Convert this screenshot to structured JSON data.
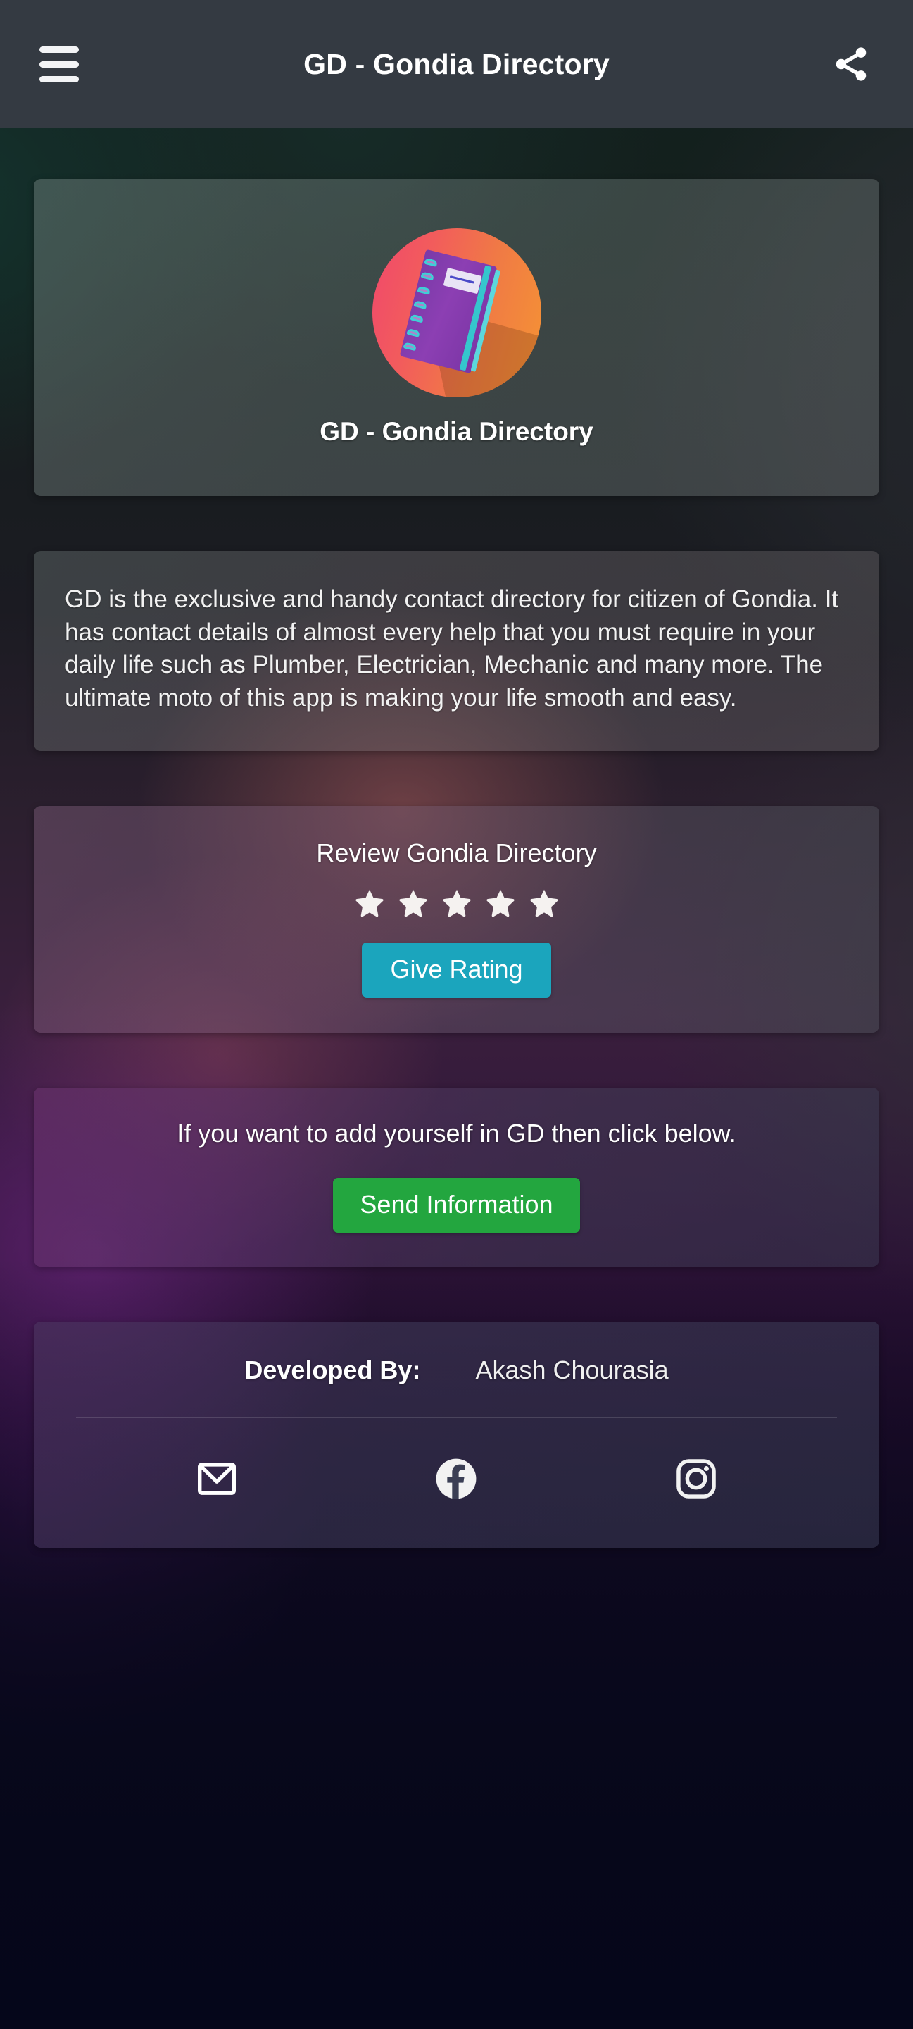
{
  "topbar": {
    "menu_icon": "hamburger-menu-icon",
    "title": "GD - Gondia Directory",
    "share_icon": "share-icon",
    "background_color": "#343a42"
  },
  "logo_card": {
    "icon_name": "gd-app-icon",
    "title": "GD - Gondia Directory"
  },
  "description_card": {
    "text": "GD is the exclusive and handy contact directory for citizen of Gondia. It has contact details of almost every help that you must require in your daily life such as Plumber, Electrician, Mechanic and many more. The ultimate moto of this app is making your life smooth and easy."
  },
  "rating_card": {
    "title": "Review Gondia Directory",
    "stars_total": 5,
    "stars_filled": 5,
    "star_color": "#f5f2f0",
    "button_label": "Give Rating",
    "button_color": "#1ba5bd"
  },
  "send_card": {
    "prompt": "If you want to add yourself in GD then click below.",
    "button_label": "Send Information",
    "button_color": "#23a63f"
  },
  "footer_card": {
    "developed_by_label": "Developed By:",
    "developer_name": "Akash Chourasia",
    "socials": [
      {
        "name": "email-icon",
        "label": "Email"
      },
      {
        "name": "facebook-icon",
        "label": "Facebook"
      },
      {
        "name": "instagram-icon",
        "label": "Instagram"
      }
    ]
  }
}
